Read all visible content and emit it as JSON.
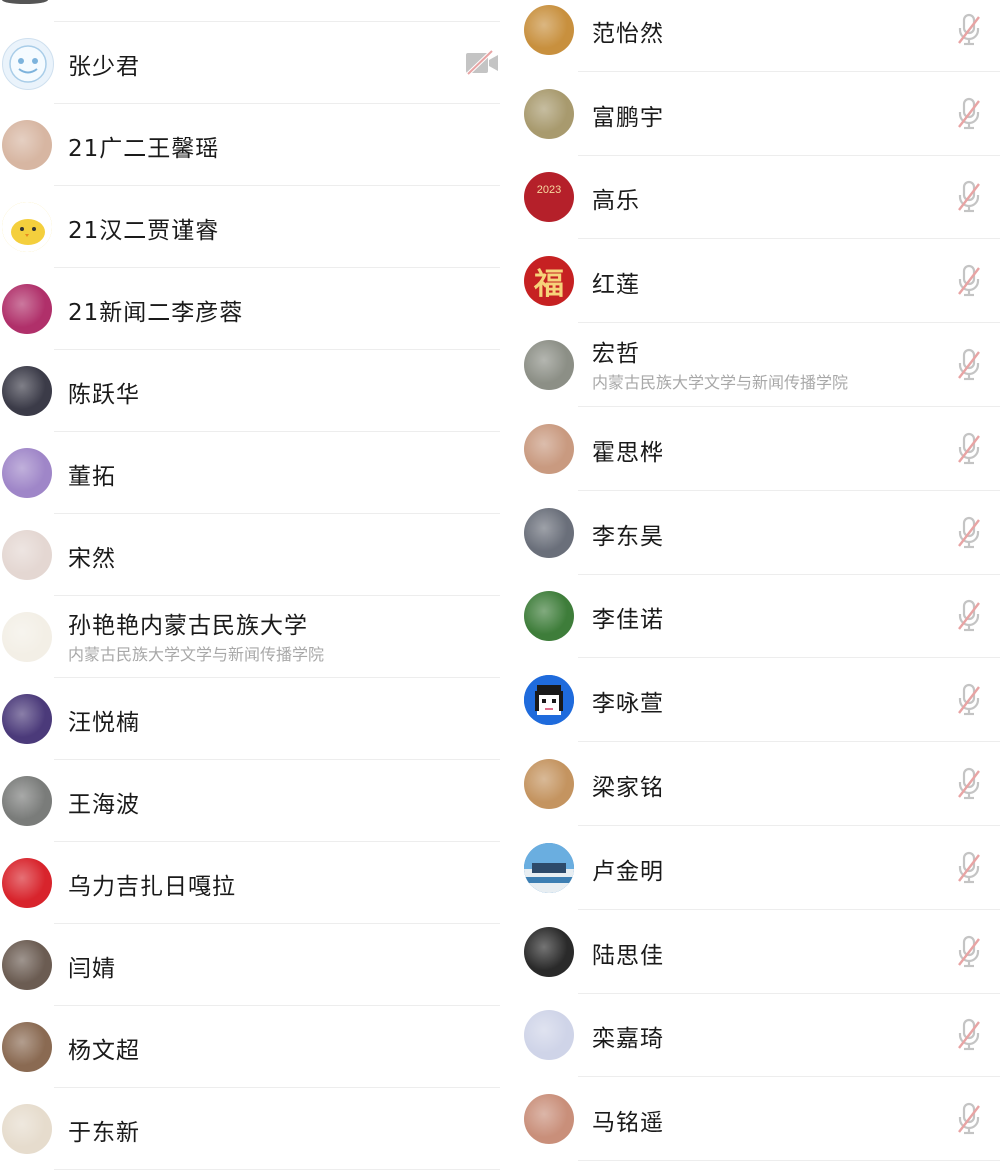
{
  "left_list": [
    {
      "name": "",
      "subtitle": "",
      "partial": true
    },
    {
      "name": "张少君",
      "subtitle": "",
      "avatar": "cartoon-face",
      "bg": "#eaf3fb",
      "status": "camera-off"
    },
    {
      "name": "21广二王馨瑶",
      "subtitle": "",
      "avatar": "photo",
      "bg": "#d7b6a2"
    },
    {
      "name": "21汉二贾谨睿",
      "subtitle": "",
      "avatar": "yellow-chick",
      "bg": "#f2d34a"
    },
    {
      "name": "21新闻二李彦蓉",
      "subtitle": "",
      "avatar": "pink-bear",
      "bg": "#b0306a"
    },
    {
      "name": "陈跃华",
      "subtitle": "",
      "avatar": "anime-boy",
      "bg": "#3b3b48"
    },
    {
      "name": "董拓",
      "subtitle": "",
      "avatar": "colorful",
      "bg": "#9f86c8"
    },
    {
      "name": "宋然",
      "subtitle": "",
      "avatar": "photo",
      "bg": "#e4d7d2"
    },
    {
      "name": "孙艳艳内蒙古民族大学",
      "subtitle": "内蒙古民族大学文学与新闻传播学院",
      "avatar": "cat-sketch",
      "bg": "#f3efe6"
    },
    {
      "name": "汪悦楠",
      "subtitle": "",
      "avatar": "photo",
      "bg": "#4b3a7a"
    },
    {
      "name": "王海波",
      "subtitle": "",
      "avatar": "building",
      "bg": "#7a7c7a"
    },
    {
      "name": "乌力吉扎日嘎拉",
      "subtitle": "",
      "avatar": "red-bg",
      "bg": "#d8242c"
    },
    {
      "name": "闫婧",
      "subtitle": "",
      "avatar": "photo",
      "bg": "#6b5c52"
    },
    {
      "name": "杨文超",
      "subtitle": "",
      "avatar": "car-photo",
      "bg": "#8a6a52"
    },
    {
      "name": "于东新",
      "subtitle": "",
      "avatar": "calligraphy",
      "bg": "#e6dccd"
    }
  ],
  "right_list": [
    {
      "name": "范怡然",
      "subtitle": "",
      "avatar": "bear-cartoon",
      "bg": "#c8903e"
    },
    {
      "name": "富鹏宇",
      "subtitle": "",
      "avatar": "photo",
      "bg": "#a89a6e"
    },
    {
      "name": "高乐",
      "subtitle": "",
      "avatar": "2023",
      "bg": "#b5202a",
      "avatar_text": "2023"
    },
    {
      "name": "红莲",
      "subtitle": "",
      "avatar": "fu",
      "bg": "#c62122",
      "avatar_text": "福"
    },
    {
      "name": "宏哲",
      "subtitle": "内蒙古民族大学文学与新闻传播学院",
      "avatar": "flowers",
      "bg": "#8c8f86"
    },
    {
      "name": "霍思桦",
      "subtitle": "",
      "avatar": "hamster",
      "bg": "#c99a80"
    },
    {
      "name": "李东昊",
      "subtitle": "",
      "avatar": "anime",
      "bg": "#6a6f7a"
    },
    {
      "name": "李佳诺",
      "subtitle": "",
      "avatar": "photo",
      "bg": "#3e7d3a"
    },
    {
      "name": "李咏萱",
      "subtitle": "",
      "avatar": "pixel-girl",
      "bg": "#1f6bdc"
    },
    {
      "name": "梁家铭",
      "subtitle": "",
      "avatar": "photo",
      "bg": "#c49460"
    },
    {
      "name": "卢金明",
      "subtitle": "",
      "avatar": "landscape",
      "bg": "#3a7fbf"
    },
    {
      "name": "陆思佳",
      "subtitle": "",
      "avatar": "photo",
      "bg": "#2a2a2a"
    },
    {
      "name": "栾嘉琦",
      "subtitle": "",
      "avatar": "person",
      "bg": "#cfd4e8"
    },
    {
      "name": "马铭遥",
      "subtitle": "",
      "avatar": "photo",
      "bg": "#c98f7a"
    }
  ],
  "icons": {
    "mic_off": "mic-off-icon",
    "camera_off": "camera-off-icon"
  },
  "colors": {
    "icon_gray": "#c4c4c4",
    "icon_slash": "#e8a4a4",
    "divider": "#ededed",
    "name_text": "#1a1a1a",
    "sub_text": "#a8a8a8"
  }
}
